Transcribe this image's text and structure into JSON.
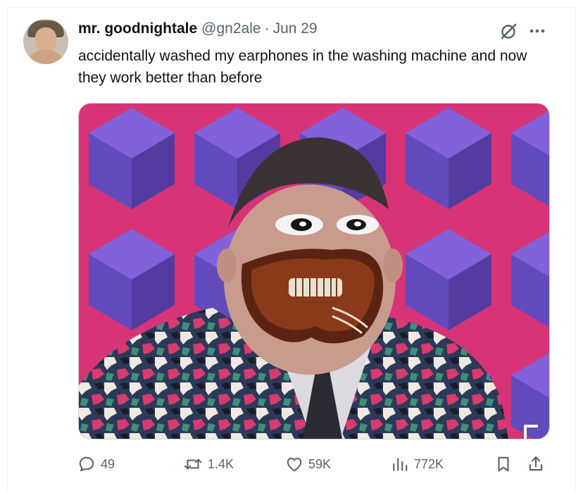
{
  "tweet": {
    "author_name": "mr. goodnightale",
    "handle": "@gn2ale",
    "separator": "·",
    "date": "Jun 29",
    "text": "accidentally washed my earphones in the washing machine and now they work better than before"
  },
  "actions": {
    "replies": "49",
    "reposts": "1.4K",
    "likes": "59K",
    "views": "772K"
  },
  "icons": {
    "avatar": "avatar-photo",
    "grok": "grok-icon",
    "more": "more-icon",
    "reply": "reply-icon",
    "repost": "repost-icon",
    "like": "heart-icon",
    "views": "views-icon",
    "bookmark": "bookmark-icon",
    "share": "share-icon"
  },
  "colors": {
    "text": "#0f1419",
    "secondary": "#536471",
    "border": "#eff3f4",
    "media_background": "#d4286e"
  }
}
